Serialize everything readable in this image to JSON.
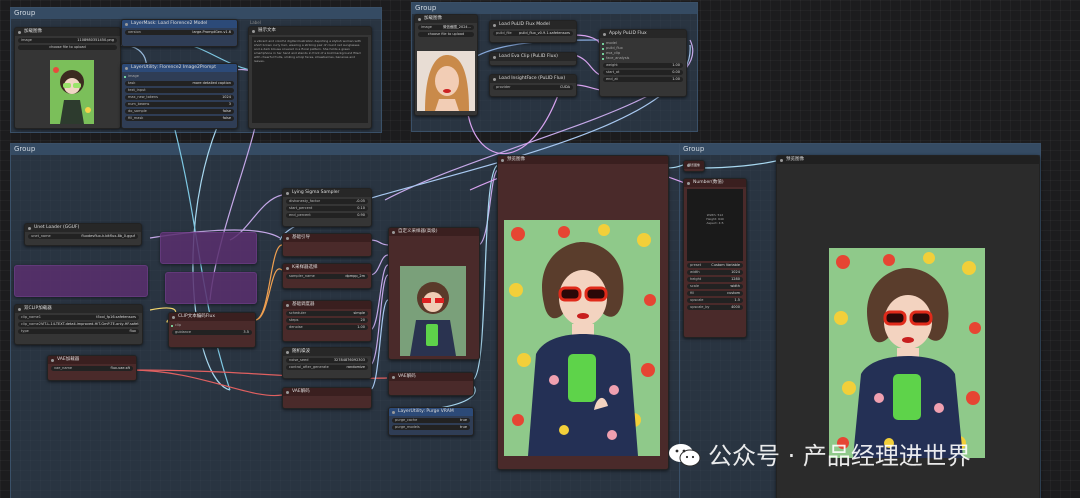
{
  "groups": {
    "top_left": "Group",
    "top_right": "Group",
    "bottom_left": "Group",
    "bottom_right": "Group"
  },
  "nodes": {
    "load_image_1": {
      "title": "加载图像",
      "file": "1108980351450.png",
      "button": "choose file to upload"
    },
    "layerMask_model": {
      "title": "LayerMask: Load Florence2 Model",
      "w1_label": "version",
      "w1_value": "large-PromptGen-v1.6"
    },
    "layerUtility_florence": {
      "title": "LayerUtility: Florence2 Image2Prompt",
      "rows": [
        [
          "task",
          "more detailed caption"
        ],
        [
          "text_input",
          ""
        ],
        [
          "max_new_tokens",
          "1024"
        ],
        [
          "num_beams",
          "3"
        ],
        [
          "do_sample",
          "false"
        ],
        [
          "fill_mask",
          "false"
        ]
      ]
    },
    "show_text": {
      "title": "展示文本",
      "label": "Label",
      "content": "a vibrant and colorful digital illustration depicting a stylish woman with short brown curly hair, wearing a striking pair of round red sunglasses and a dark blouse covered in a floral pattern. She holds a green smartphone in her hand and stands in front of a bold background filled with cheerful fruits, smiling emoji faces, strawberries, bananas and leaves."
    },
    "load_image_2": {
      "title": "加载图像",
      "file": "微信截图_2024...",
      "button": "choose file to upload"
    },
    "load_pulid_model": {
      "title": "Load PuLID Flux Model",
      "w1_label": "pulid_file",
      "w1_value": "pulid_flux_v0.9.1.safetensors"
    },
    "load_eva_clip": {
      "title": "Load Eva Clip (PuLID Flux)"
    },
    "load_insightface": {
      "title": "Load InsightFace (PuLID Flux)",
      "w1_label": "provider",
      "w1_value": "CUDA"
    },
    "apply_pulid": {
      "title": "Apply PuLID Flux",
      "rows": [
        [
          "weight",
          "1.00"
        ],
        [
          "start_at",
          "0.00"
        ],
        [
          "end_at",
          "1.00"
        ]
      ]
    },
    "unet_loader": {
      "title": "Unet Loader (GGUF)",
      "w1_label": "unet_name",
      "w1_value": "fluxdevflux-k.bitflux-8b_0.gguf"
    },
    "lying_sigma": {
      "title": "Lying Sigma Sampler",
      "rows": [
        [
          "dishonesty_factor",
          "-0.05"
        ],
        [
          "start_percent",
          "0.10"
        ],
        [
          "end_percent",
          "0.90"
        ]
      ]
    },
    "basic_guider": {
      "title": "基础引导"
    },
    "ksampler_select": {
      "title": "K采样器选择",
      "w1_label": "sampler_name",
      "w1_value": "dpmpp_2m"
    },
    "basic_scheduler": {
      "title": "基础调度器",
      "rows": [
        [
          "scheduler",
          "simple"
        ],
        [
          "steps",
          "20"
        ],
        [
          "denoise",
          "1.00"
        ]
      ]
    },
    "random_noise": {
      "title": "随机噪波",
      "rows": [
        [
          "noise_seed",
          "32784876092303"
        ],
        [
          "control_after_generate",
          "randomize"
        ]
      ]
    },
    "custom_sampler": {
      "title": "自定义采样器(高级)"
    },
    "dual_clip": {
      "title": "双CLIP加载器",
      "rows": [
        [
          "clip_name1",
          "t5xxl_fp16.safetensors"
        ],
        [
          "clip_name2",
          "ViT-L-14-TEXT-detail-improved-HiT-GmP-TE-only-HF.safet"
        ],
        [
          "type",
          "flux"
        ]
      ]
    },
    "clip_encode": {
      "title": "CLIP文本编码Flux",
      "w1_label": "guidance",
      "w1_value": "3.5"
    },
    "vae_loader": {
      "title": "VAE加载器",
      "w1_label": "vae_name",
      "w1_value": "flux-vae.sft"
    },
    "vae_decode_small": {
      "title": "VAE解码"
    },
    "vae_decode": {
      "title": "VAE解码"
    },
    "purge_vram": {
      "title": "LayerUtility: Purge VRAM",
      "rows": [
        [
          "purge_cache",
          "true"
        ],
        [
          "purge_models",
          "true"
        ]
      ]
    },
    "preview_1": {
      "title": "预览图像"
    },
    "preview_2": {
      "title": "预览图像"
    },
    "preview_small": {
      "title": "预览图像"
    },
    "number_node": {
      "title": "Number(数值)",
      "lines": [
        "Width: 512",
        "Height: 640",
        "Aspect: 4:5"
      ],
      "rows": [
        [
          "preset",
          "Custom Variable"
        ],
        [
          "width",
          "1024"
        ],
        [
          "height",
          "1280"
        ],
        [
          "scale",
          "width"
        ],
        [
          "fill",
          "custom"
        ],
        [
          "upscale",
          "1.5"
        ],
        [
          "upscale_by",
          "4000"
        ]
      ]
    }
  },
  "watermark": {
    "text": "公众号 · 产品经理进世界"
  }
}
